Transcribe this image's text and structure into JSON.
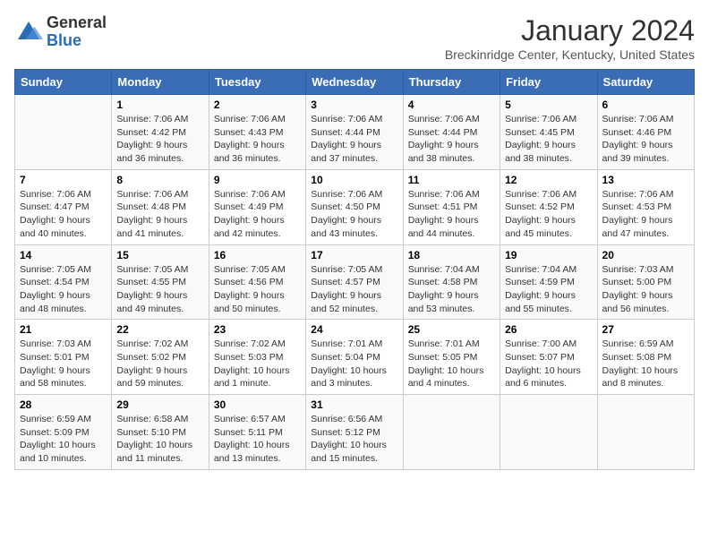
{
  "logo": {
    "general": "General",
    "blue": "Blue"
  },
  "title": "January 2024",
  "location": "Breckinridge Center, Kentucky, United States",
  "days_of_week": [
    "Sunday",
    "Monday",
    "Tuesday",
    "Wednesday",
    "Thursday",
    "Friday",
    "Saturday"
  ],
  "weeks": [
    [
      {
        "day": "",
        "info": ""
      },
      {
        "day": "1",
        "info": "Sunrise: 7:06 AM\nSunset: 4:42 PM\nDaylight: 9 hours\nand 36 minutes."
      },
      {
        "day": "2",
        "info": "Sunrise: 7:06 AM\nSunset: 4:43 PM\nDaylight: 9 hours\nand 36 minutes."
      },
      {
        "day": "3",
        "info": "Sunrise: 7:06 AM\nSunset: 4:44 PM\nDaylight: 9 hours\nand 37 minutes."
      },
      {
        "day": "4",
        "info": "Sunrise: 7:06 AM\nSunset: 4:44 PM\nDaylight: 9 hours\nand 38 minutes."
      },
      {
        "day": "5",
        "info": "Sunrise: 7:06 AM\nSunset: 4:45 PM\nDaylight: 9 hours\nand 38 minutes."
      },
      {
        "day": "6",
        "info": "Sunrise: 7:06 AM\nSunset: 4:46 PM\nDaylight: 9 hours\nand 39 minutes."
      }
    ],
    [
      {
        "day": "7",
        "info": "Sunrise: 7:06 AM\nSunset: 4:47 PM\nDaylight: 9 hours\nand 40 minutes."
      },
      {
        "day": "8",
        "info": "Sunrise: 7:06 AM\nSunset: 4:48 PM\nDaylight: 9 hours\nand 41 minutes."
      },
      {
        "day": "9",
        "info": "Sunrise: 7:06 AM\nSunset: 4:49 PM\nDaylight: 9 hours\nand 42 minutes."
      },
      {
        "day": "10",
        "info": "Sunrise: 7:06 AM\nSunset: 4:50 PM\nDaylight: 9 hours\nand 43 minutes."
      },
      {
        "day": "11",
        "info": "Sunrise: 7:06 AM\nSunset: 4:51 PM\nDaylight: 9 hours\nand 44 minutes."
      },
      {
        "day": "12",
        "info": "Sunrise: 7:06 AM\nSunset: 4:52 PM\nDaylight: 9 hours\nand 45 minutes."
      },
      {
        "day": "13",
        "info": "Sunrise: 7:06 AM\nSunset: 4:53 PM\nDaylight: 9 hours\nand 47 minutes."
      }
    ],
    [
      {
        "day": "14",
        "info": "Sunrise: 7:05 AM\nSunset: 4:54 PM\nDaylight: 9 hours\nand 48 minutes."
      },
      {
        "day": "15",
        "info": "Sunrise: 7:05 AM\nSunset: 4:55 PM\nDaylight: 9 hours\nand 49 minutes."
      },
      {
        "day": "16",
        "info": "Sunrise: 7:05 AM\nSunset: 4:56 PM\nDaylight: 9 hours\nand 50 minutes."
      },
      {
        "day": "17",
        "info": "Sunrise: 7:05 AM\nSunset: 4:57 PM\nDaylight: 9 hours\nand 52 minutes."
      },
      {
        "day": "18",
        "info": "Sunrise: 7:04 AM\nSunset: 4:58 PM\nDaylight: 9 hours\nand 53 minutes."
      },
      {
        "day": "19",
        "info": "Sunrise: 7:04 AM\nSunset: 4:59 PM\nDaylight: 9 hours\nand 55 minutes."
      },
      {
        "day": "20",
        "info": "Sunrise: 7:03 AM\nSunset: 5:00 PM\nDaylight: 9 hours\nand 56 minutes."
      }
    ],
    [
      {
        "day": "21",
        "info": "Sunrise: 7:03 AM\nSunset: 5:01 PM\nDaylight: 9 hours\nand 58 minutes."
      },
      {
        "day": "22",
        "info": "Sunrise: 7:02 AM\nSunset: 5:02 PM\nDaylight: 9 hours\nand 59 minutes."
      },
      {
        "day": "23",
        "info": "Sunrise: 7:02 AM\nSunset: 5:03 PM\nDaylight: 10 hours\nand 1 minute."
      },
      {
        "day": "24",
        "info": "Sunrise: 7:01 AM\nSunset: 5:04 PM\nDaylight: 10 hours\nand 3 minutes."
      },
      {
        "day": "25",
        "info": "Sunrise: 7:01 AM\nSunset: 5:05 PM\nDaylight: 10 hours\nand 4 minutes."
      },
      {
        "day": "26",
        "info": "Sunrise: 7:00 AM\nSunset: 5:07 PM\nDaylight: 10 hours\nand 6 minutes."
      },
      {
        "day": "27",
        "info": "Sunrise: 6:59 AM\nSunset: 5:08 PM\nDaylight: 10 hours\nand 8 minutes."
      }
    ],
    [
      {
        "day": "28",
        "info": "Sunrise: 6:59 AM\nSunset: 5:09 PM\nDaylight: 10 hours\nand 10 minutes."
      },
      {
        "day": "29",
        "info": "Sunrise: 6:58 AM\nSunset: 5:10 PM\nDaylight: 10 hours\nand 11 minutes."
      },
      {
        "day": "30",
        "info": "Sunrise: 6:57 AM\nSunset: 5:11 PM\nDaylight: 10 hours\nand 13 minutes."
      },
      {
        "day": "31",
        "info": "Sunrise: 6:56 AM\nSunset: 5:12 PM\nDaylight: 10 hours\nand 15 minutes."
      },
      {
        "day": "",
        "info": ""
      },
      {
        "day": "",
        "info": ""
      },
      {
        "day": "",
        "info": ""
      }
    ]
  ]
}
